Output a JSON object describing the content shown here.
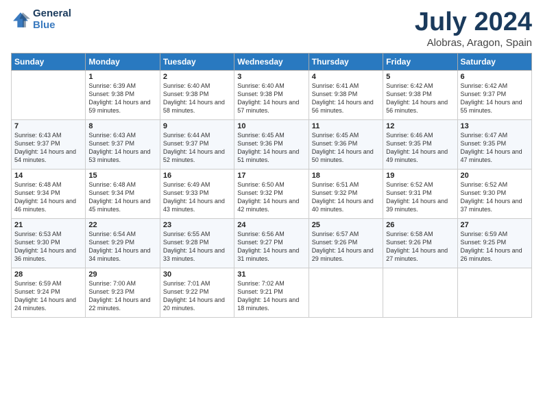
{
  "logo": {
    "line1": "General",
    "line2": "Blue"
  },
  "title": "July 2024",
  "subtitle": "Alobras, Aragon, Spain",
  "weekdays": [
    "Sunday",
    "Monday",
    "Tuesday",
    "Wednesday",
    "Thursday",
    "Friday",
    "Saturday"
  ],
  "weeks": [
    [
      {
        "day": "",
        "sunrise": "",
        "sunset": "",
        "daylight": ""
      },
      {
        "day": "1",
        "sunrise": "Sunrise: 6:39 AM",
        "sunset": "Sunset: 9:38 PM",
        "daylight": "Daylight: 14 hours and 59 minutes."
      },
      {
        "day": "2",
        "sunrise": "Sunrise: 6:40 AM",
        "sunset": "Sunset: 9:38 PM",
        "daylight": "Daylight: 14 hours and 58 minutes."
      },
      {
        "day": "3",
        "sunrise": "Sunrise: 6:40 AM",
        "sunset": "Sunset: 9:38 PM",
        "daylight": "Daylight: 14 hours and 57 minutes."
      },
      {
        "day": "4",
        "sunrise": "Sunrise: 6:41 AM",
        "sunset": "Sunset: 9:38 PM",
        "daylight": "Daylight: 14 hours and 56 minutes."
      },
      {
        "day": "5",
        "sunrise": "Sunrise: 6:42 AM",
        "sunset": "Sunset: 9:38 PM",
        "daylight": "Daylight: 14 hours and 56 minutes."
      },
      {
        "day": "6",
        "sunrise": "Sunrise: 6:42 AM",
        "sunset": "Sunset: 9:37 PM",
        "daylight": "Daylight: 14 hours and 55 minutes."
      }
    ],
    [
      {
        "day": "7",
        "sunrise": "Sunrise: 6:43 AM",
        "sunset": "Sunset: 9:37 PM",
        "daylight": "Daylight: 14 hours and 54 minutes."
      },
      {
        "day": "8",
        "sunrise": "Sunrise: 6:43 AM",
        "sunset": "Sunset: 9:37 PM",
        "daylight": "Daylight: 14 hours and 53 minutes."
      },
      {
        "day": "9",
        "sunrise": "Sunrise: 6:44 AM",
        "sunset": "Sunset: 9:37 PM",
        "daylight": "Daylight: 14 hours and 52 minutes."
      },
      {
        "day": "10",
        "sunrise": "Sunrise: 6:45 AM",
        "sunset": "Sunset: 9:36 PM",
        "daylight": "Daylight: 14 hours and 51 minutes."
      },
      {
        "day": "11",
        "sunrise": "Sunrise: 6:45 AM",
        "sunset": "Sunset: 9:36 PM",
        "daylight": "Daylight: 14 hours and 50 minutes."
      },
      {
        "day": "12",
        "sunrise": "Sunrise: 6:46 AM",
        "sunset": "Sunset: 9:35 PM",
        "daylight": "Daylight: 14 hours and 49 minutes."
      },
      {
        "day": "13",
        "sunrise": "Sunrise: 6:47 AM",
        "sunset": "Sunset: 9:35 PM",
        "daylight": "Daylight: 14 hours and 47 minutes."
      }
    ],
    [
      {
        "day": "14",
        "sunrise": "Sunrise: 6:48 AM",
        "sunset": "Sunset: 9:34 PM",
        "daylight": "Daylight: 14 hours and 46 minutes."
      },
      {
        "day": "15",
        "sunrise": "Sunrise: 6:48 AM",
        "sunset": "Sunset: 9:34 PM",
        "daylight": "Daylight: 14 hours and 45 minutes."
      },
      {
        "day": "16",
        "sunrise": "Sunrise: 6:49 AM",
        "sunset": "Sunset: 9:33 PM",
        "daylight": "Daylight: 14 hours and 43 minutes."
      },
      {
        "day": "17",
        "sunrise": "Sunrise: 6:50 AM",
        "sunset": "Sunset: 9:32 PM",
        "daylight": "Daylight: 14 hours and 42 minutes."
      },
      {
        "day": "18",
        "sunrise": "Sunrise: 6:51 AM",
        "sunset": "Sunset: 9:32 PM",
        "daylight": "Daylight: 14 hours and 40 minutes."
      },
      {
        "day": "19",
        "sunrise": "Sunrise: 6:52 AM",
        "sunset": "Sunset: 9:31 PM",
        "daylight": "Daylight: 14 hours and 39 minutes."
      },
      {
        "day": "20",
        "sunrise": "Sunrise: 6:52 AM",
        "sunset": "Sunset: 9:30 PM",
        "daylight": "Daylight: 14 hours and 37 minutes."
      }
    ],
    [
      {
        "day": "21",
        "sunrise": "Sunrise: 6:53 AM",
        "sunset": "Sunset: 9:30 PM",
        "daylight": "Daylight: 14 hours and 36 minutes."
      },
      {
        "day": "22",
        "sunrise": "Sunrise: 6:54 AM",
        "sunset": "Sunset: 9:29 PM",
        "daylight": "Daylight: 14 hours and 34 minutes."
      },
      {
        "day": "23",
        "sunrise": "Sunrise: 6:55 AM",
        "sunset": "Sunset: 9:28 PM",
        "daylight": "Daylight: 14 hours and 33 minutes."
      },
      {
        "day": "24",
        "sunrise": "Sunrise: 6:56 AM",
        "sunset": "Sunset: 9:27 PM",
        "daylight": "Daylight: 14 hours and 31 minutes."
      },
      {
        "day": "25",
        "sunrise": "Sunrise: 6:57 AM",
        "sunset": "Sunset: 9:26 PM",
        "daylight": "Daylight: 14 hours and 29 minutes."
      },
      {
        "day": "26",
        "sunrise": "Sunrise: 6:58 AM",
        "sunset": "Sunset: 9:26 PM",
        "daylight": "Daylight: 14 hours and 27 minutes."
      },
      {
        "day": "27",
        "sunrise": "Sunrise: 6:59 AM",
        "sunset": "Sunset: 9:25 PM",
        "daylight": "Daylight: 14 hours and 26 minutes."
      }
    ],
    [
      {
        "day": "28",
        "sunrise": "Sunrise: 6:59 AM",
        "sunset": "Sunset: 9:24 PM",
        "daylight": "Daylight: 14 hours and 24 minutes."
      },
      {
        "day": "29",
        "sunrise": "Sunrise: 7:00 AM",
        "sunset": "Sunset: 9:23 PM",
        "daylight": "Daylight: 14 hours and 22 minutes."
      },
      {
        "day": "30",
        "sunrise": "Sunrise: 7:01 AM",
        "sunset": "Sunset: 9:22 PM",
        "daylight": "Daylight: 14 hours and 20 minutes."
      },
      {
        "day": "31",
        "sunrise": "Sunrise: 7:02 AM",
        "sunset": "Sunset: 9:21 PM",
        "daylight": "Daylight: 14 hours and 18 minutes."
      },
      {
        "day": "",
        "sunrise": "",
        "sunset": "",
        "daylight": ""
      },
      {
        "day": "",
        "sunrise": "",
        "sunset": "",
        "daylight": ""
      },
      {
        "day": "",
        "sunrise": "",
        "sunset": "",
        "daylight": ""
      }
    ]
  ]
}
